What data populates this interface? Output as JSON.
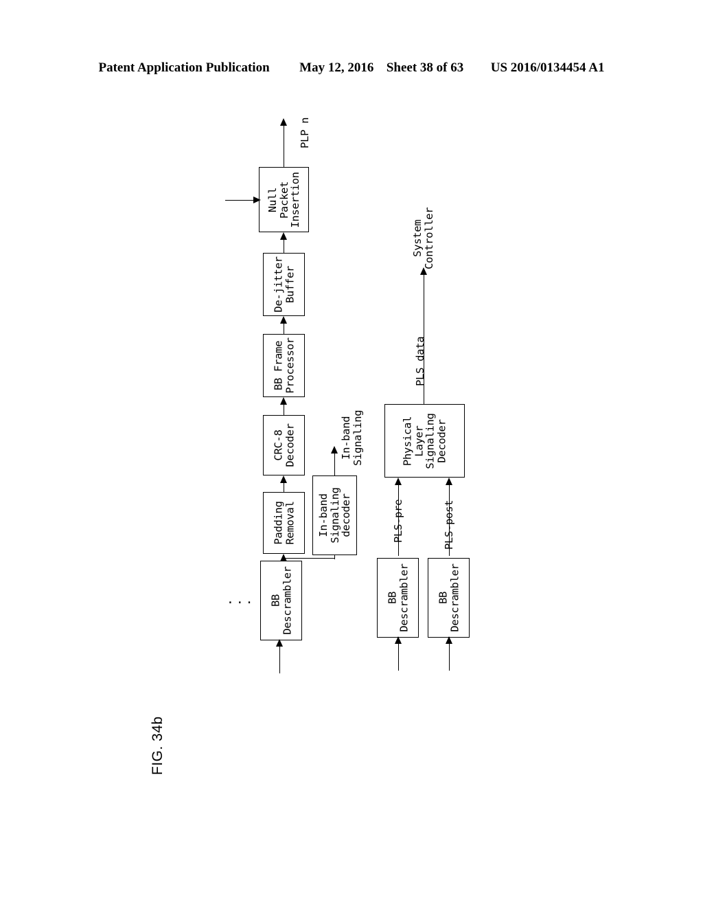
{
  "header": {
    "publication": "Patent Application Publication",
    "date": "May 12, 2016",
    "sheet": "Sheet 38 of 63",
    "patent_number": "US 2016/0134454 A1"
  },
  "figure": {
    "label": "FIG. 34b",
    "ellipsis": "..."
  },
  "blocks": {
    "null_packet_insertion": {
      "lines": [
        "Null",
        "Packet",
        "Insertion"
      ]
    },
    "de_jitter_buffer": {
      "lines": [
        "De-jitter",
        "Buffer"
      ]
    },
    "bb_frame_processor": {
      "lines": [
        "BB Frame",
        "Processor"
      ]
    },
    "crc8_decoder": {
      "lines": [
        "CRC-8",
        "Decoder"
      ]
    },
    "padding_removal": {
      "lines": [
        "Padding",
        "Removal"
      ]
    },
    "inband_signaling_decoder": {
      "lines": [
        "In-band",
        "Signaling",
        "decoder"
      ]
    },
    "bb_descrambler_data": {
      "lines": [
        "BB",
        "Descrambler"
      ]
    },
    "physical_layer_signaling_decoder": {
      "lines": [
        "Physical",
        "Layer",
        "Signaling",
        "Decoder"
      ]
    },
    "bb_descrambler_pre": {
      "lines": [
        "BB",
        "Descrambler"
      ]
    },
    "bb_descrambler_post": {
      "lines": [
        "BB",
        "Descrambler"
      ]
    }
  },
  "signal_labels": {
    "plp_n": "PLP n",
    "inband_signaling": {
      "lines": [
        "In-band",
        "Signaling"
      ]
    },
    "pls_data": "PLS data",
    "system_controller": {
      "lines": [
        "System",
        "Controller"
      ]
    },
    "pls_pre": "PLS-pre",
    "pls_post": "PLS-post"
  },
  "colors": {
    "ink": "#000000",
    "paper": "#ffffff"
  }
}
